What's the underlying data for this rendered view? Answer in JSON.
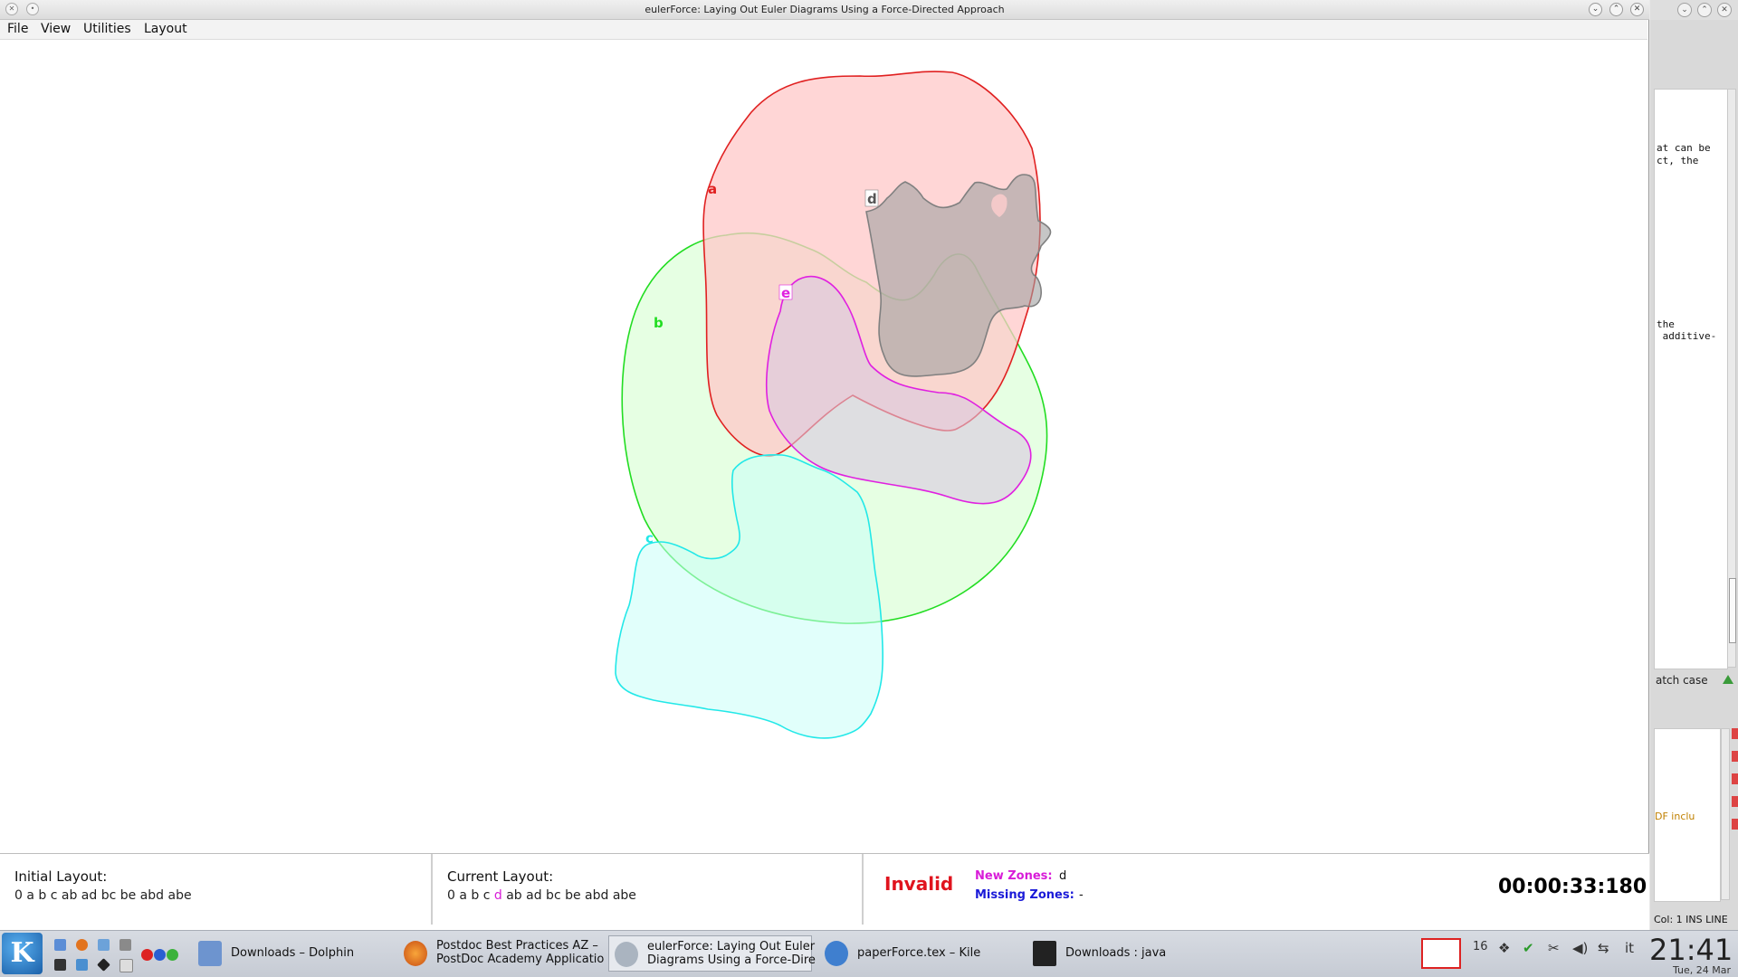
{
  "window": {
    "title": "eulerForce: Laying Out Euler Diagrams Using a Force-Directed Approach"
  },
  "menu": [
    "File",
    "View",
    "Utilities",
    "Layout"
  ],
  "diagram": {
    "curves": [
      {
        "label": "a",
        "color": "#e02020",
        "fill": "#ffc8c8"
      },
      {
        "label": "b",
        "color": "#22dd22",
        "fill": "#c8ffc0"
      },
      {
        "label": "c",
        "color": "#22e8e8",
        "fill": "#c8fff8"
      },
      {
        "label": "d",
        "color": "#808080",
        "fill": "#a0a0a0"
      },
      {
        "label": "e",
        "color": "#e020e0",
        "fill": "#d8c8e0"
      }
    ]
  },
  "info": {
    "initial_title": "Initial Layout:",
    "initial_prefix": "0 a b c ab ad bc be abd abe",
    "current_title": "Current Layout:",
    "current_prefix": "0 a b c",
    "current_highlight": "d",
    "current_suffix": "ab ad bc be abd abe",
    "status": "Invalid",
    "new_zones_label": "New Zones:",
    "new_zones_value": "d",
    "missing_zones_label": "Missing Zones:",
    "missing_zones_value": "-",
    "timer": "00:00:33:180"
  },
  "bg_window": {
    "lines": [
      "at can be",
      "ct, the",
      "the",
      " additive-"
    ],
    "find_label": "atch case",
    "log_text": "DF inclu",
    "status": "Col: 1  INS  LINE"
  },
  "taskbar": {
    "tasks": [
      {
        "label": "Downloads – Dolphin",
        "icon": "dolphin-icon"
      },
      {
        "label_line1": "Postdoc Best Practices AZ –",
        "label_line2": "PostDoc Academy Applicatio",
        "icon": "firefox-icon"
      },
      {
        "label_line1": "eulerForce: Laying Out Euler",
        "label_line2": "Diagrams Using a Force-Dire",
        "icon": "java-icon"
      },
      {
        "label": "paperForce.tex – Kile",
        "icon": "kile-icon"
      },
      {
        "label": "Downloads : java",
        "icon": "terminal-icon"
      }
    ],
    "tray_desktop": "16",
    "tray_lang": "it",
    "clock": "21:41",
    "date": "Tue, 24 Mar"
  }
}
